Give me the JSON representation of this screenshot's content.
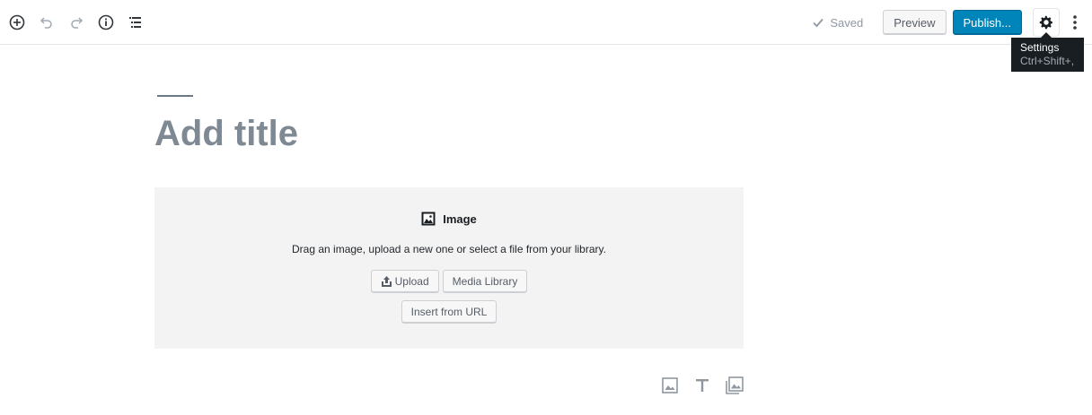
{
  "toolbar": {
    "left_icons": [
      "add-block-icon",
      "undo-icon",
      "redo-icon",
      "info-icon",
      "outline-icon"
    ],
    "saved_label": "Saved",
    "preview_label": "Preview",
    "publish_label": "Publish...",
    "settings_icon": "gear-icon",
    "more_icon": "more-vertical-icon"
  },
  "tooltip": {
    "title": "Settings",
    "shortcut": "Ctrl+Shift+,"
  },
  "editor": {
    "title_placeholder": "Add title"
  },
  "image_block": {
    "label": "Image",
    "instructions": "Drag an image, upload a new one or select a file from your library.",
    "upload_label": "Upload",
    "media_library_label": "Media Library",
    "insert_url_label": "Insert from URL"
  },
  "inserter": {
    "icons": [
      "image-icon",
      "heading-icon",
      "gallery-icon"
    ]
  },
  "colors": {
    "primary": "#0085ba",
    "text_muted": "#8f98a1",
    "block_bg": "#f3f3f3"
  }
}
